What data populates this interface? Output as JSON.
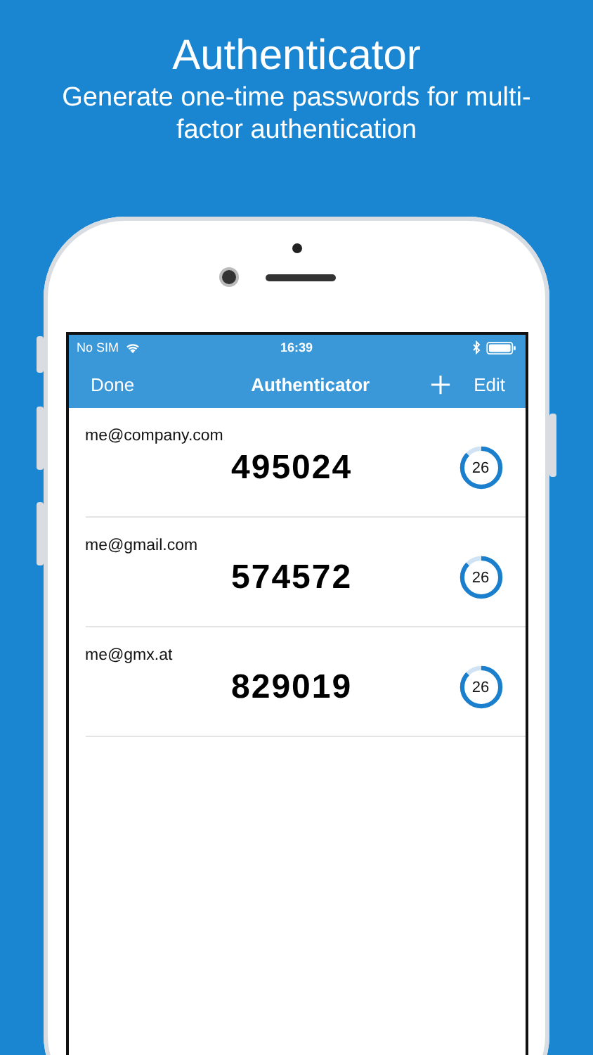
{
  "headline": {
    "title": "Authenticator",
    "subtitle": "Generate one-time passwords for multi-factor authentication"
  },
  "status_bar": {
    "carrier": "No SIM",
    "time": "16:39"
  },
  "nav_bar": {
    "left": "Done",
    "title": "Authenticator",
    "right": "Edit"
  },
  "accounts": [
    {
      "name": "me@company.com",
      "code": "495024",
      "seconds": "26",
      "level": 0.87
    },
    {
      "name": "me@gmail.com",
      "code": "574572",
      "seconds": "26",
      "level": 0.87
    },
    {
      "name": "me@gmx.at",
      "code": "829019",
      "seconds": "26",
      "level": 0.87
    }
  ]
}
